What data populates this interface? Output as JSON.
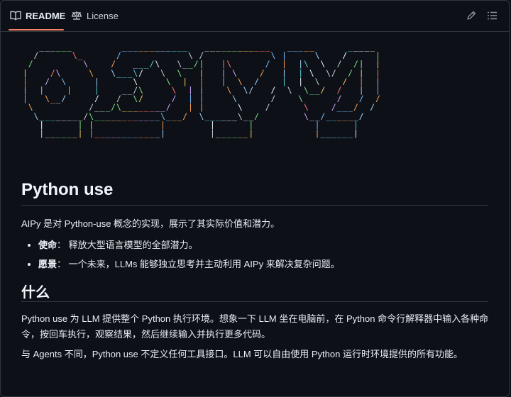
{
  "tabs": {
    "readme": "README",
    "license": "License"
  },
  "ascii_art": [
    "   ______         ____________   ____________   _____      _____",
    "  /      \\_      /            \\ /            \\ |     \\    /     |",
    " /         \\    /   ___/\\   \\__/|   |\\      /  |  |\\  \\  /  /|  |",
    "|    /\\     \\   \\___\\/   \\  \\   |   | \\    /   |  | \\  \\/  / |  |",
    "|   /  \\     |      \\     \\  |  |   |  \\  /    |  |  \\    /  |  |",
    "|  |    |    |    __/\\     \\  | |    \\  \\/   /  \\  \\__/  /   |  |",
    "|   \\__/     /   /  \\/     /  | |     \\      /    \\      /   /  /",
    " \\          /___/\\________/   | |      \\    /      \\    /___/  /",
    "  \\________/\\____________\\___/  \\______\\__/        \\__/______/",
    "   |      | |            |        |      |           |      |",
    "   |______| |____________|        |______|           |______|"
  ],
  "heading": "Python use",
  "intro": "AIPy 是对 Python-use 概念的实现，展示了其实际价值和潜力。",
  "bullets": [
    {
      "term": "使命",
      "text": "： 释放大型语言模型的全部潜力。"
    },
    {
      "term": "愿景",
      "text": "： 一个未来，LLMs 能够独立思考并主动利用 AIPy 来解决复杂问题。"
    }
  ],
  "subheading": "什么",
  "para1": "Python use 为 LLM 提供整个 Python 执行环境。想象一下 LLM 坐在电脑前，在 Python 命令行解释器中输入各种命令，按回车执行，观察结果，然后继续输入并执行更多代码。",
  "para2": "与 Agents 不同，Python use 不定义任何工具接口。LLM 可以自由使用 Python 运行时环境提供的所有功能。",
  "colors": {
    "background": "#0d1117",
    "border": "#30363d",
    "accent_underline": "#f78166",
    "text": "#e6edf3"
  },
  "icons": {
    "readme": "book-icon",
    "license": "scale-icon",
    "edit": "pencil-icon",
    "outline": "list-icon"
  }
}
